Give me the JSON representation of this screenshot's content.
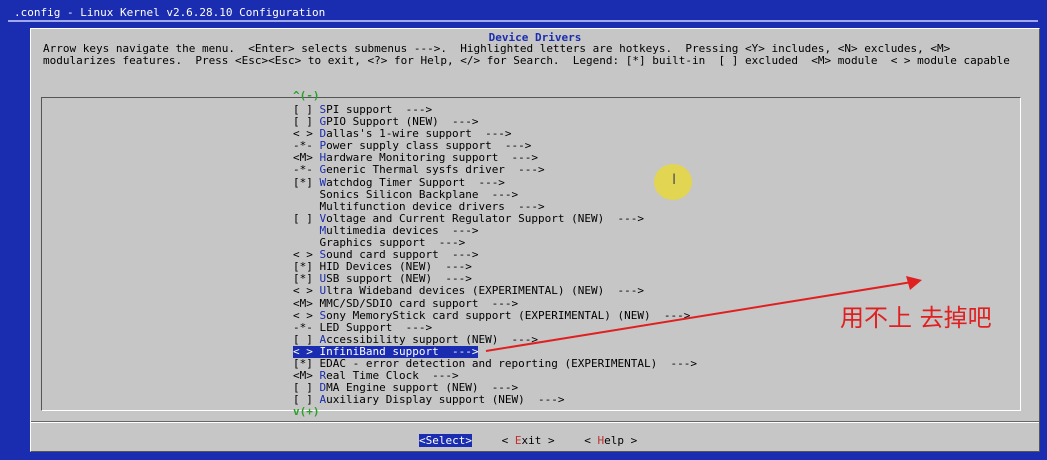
{
  "window": {
    "title": ".config - Linux Kernel v2.6.28.10 Configuration"
  },
  "dialog": {
    "title": "Device Drivers",
    "help_line_1": "Arrow keys navigate the menu.  <Enter> selects submenus --->.  Highlighted letters are hotkeys.  Pressing <Y> includes, <N> excludes, <M>",
    "help_line_2": "modularizes features.  Press <Esc><Esc> to exit, <?> for Help, </> for Search.  Legend: [*] built-in  [ ] excluded  <M> module  < > module capable",
    "scroll_up": "^(-)",
    "scroll_down": "v(+)"
  },
  "menu": {
    "items": [
      {
        "prefix": "[ ] ",
        "hot": "S",
        "rest": "PI support  --->"
      },
      {
        "prefix": "[ ] ",
        "hot": "G",
        "rest": "PIO Support (NEW)  --->"
      },
      {
        "prefix": "< > ",
        "hot": "D",
        "rest": "allas's 1-wire support  --->"
      },
      {
        "prefix": "-*- ",
        "hot": "P",
        "rest": "ower supply class support  --->"
      },
      {
        "prefix": "<M> ",
        "hot": "H",
        "rest": "ardware Monitoring support  --->"
      },
      {
        "prefix": "-*- ",
        "hot": "G",
        "rest": "eneric Thermal sysfs driver  --->"
      },
      {
        "prefix": "[*] ",
        "hot": "W",
        "rest": "atchdog Timer Support  --->"
      },
      {
        "prefix": "    ",
        "hot": "",
        "rest": "Sonics Silicon Backplane  --->"
      },
      {
        "prefix": "    ",
        "hot": "",
        "rest": "Multifunction device drivers  --->"
      },
      {
        "prefix": "[ ] ",
        "hot": "V",
        "rest": "oltage and Current Regulator Support (NEW)  --->"
      },
      {
        "prefix": "    ",
        "hot": "M",
        "rest": "ultimedia devices  --->"
      },
      {
        "prefix": "    ",
        "hot": "",
        "rest": "Graphics support  --->"
      },
      {
        "prefix": "< > ",
        "hot": "S",
        "rest": "ound card support  --->"
      },
      {
        "prefix": "[*] ",
        "hot": "",
        "rest": "HID Devices (NEW)  --->"
      },
      {
        "prefix": "[*] ",
        "hot": "U",
        "rest": "SB support (NEW)  --->"
      },
      {
        "prefix": "< > ",
        "hot": "U",
        "rest": "ltra Wideband devices (EXPERIMENTAL) (NEW)  --->"
      },
      {
        "prefix": "<M> ",
        "hot": "",
        "rest": "MMC/SD/SDIO card support  --->"
      },
      {
        "prefix": "< > ",
        "hot": "S",
        "rest": "ony MemoryStick card support (EXPERIMENTAL) (NEW)  --->"
      },
      {
        "prefix": "-*- ",
        "hot": "",
        "rest": "LED Support  --->"
      },
      {
        "prefix": "[ ] ",
        "hot": "A",
        "rest": "ccessibility support (NEW)  --->"
      },
      {
        "prefix": "< > ",
        "hot": "I",
        "rest": "nfiniBand support  --->",
        "selected": true
      },
      {
        "prefix": "[*] ",
        "hot": "",
        "rest": "EDAC - error detection and reporting (EXPERIMENTAL)  --->"
      },
      {
        "prefix": "<M> ",
        "hot": "R",
        "rest": "eal Time Clock  --->"
      },
      {
        "prefix": "[ ] ",
        "hot": "D",
        "rest": "MA Engine support (NEW)  --->"
      },
      {
        "prefix": "[ ] ",
        "hot": "A",
        "rest": "uxiliary Display support (NEW)  --->"
      }
    ]
  },
  "buttons": {
    "select": {
      "left": "<",
      "hot": "S",
      "rest": "elect",
      "right": ">"
    },
    "exit": {
      "left": "< ",
      "hot": "E",
      "rest": "xit",
      "right": " >"
    },
    "help": {
      "left": "< ",
      "hot": "H",
      "rest": "elp",
      "right": " >"
    }
  },
  "annotation": {
    "text": "用不上 去掉吧",
    "color": "#e02020"
  },
  "colors": {
    "background": "#1a2cb0",
    "dialog": "#c6c6c6",
    "hotkey": "#1a2cb0",
    "highlight": "#1a2cb0",
    "scroll_indicator": "#2aa02a"
  },
  "icons": {
    "cursor": "text-cursor-icon"
  }
}
